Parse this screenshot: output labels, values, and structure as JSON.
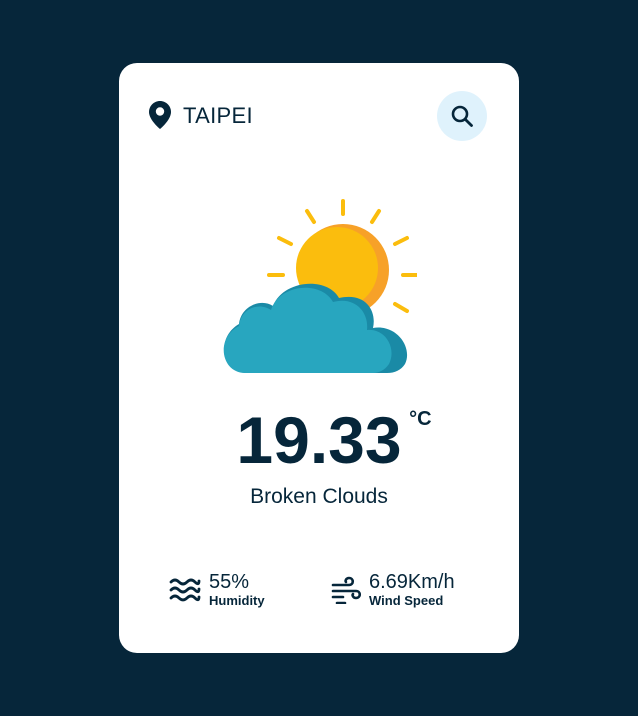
{
  "location": {
    "city": "TAIPEI",
    "icon": "location-pin-icon"
  },
  "search": {
    "icon": "search-icon",
    "bg_color": "#dff2fc"
  },
  "weather": {
    "icon": "sun-behind-cloud-icon",
    "temperature": "19.33",
    "unit": "°C",
    "description": "Broken Clouds"
  },
  "stats": {
    "humidity": {
      "value": "55%",
      "label": "Humidity",
      "icon": "waves-icon"
    },
    "wind": {
      "value": "6.69Km/h",
      "label": "Wind Speed",
      "icon": "wind-icon"
    }
  },
  "colors": {
    "background": "#06263a",
    "card": "#ffffff",
    "text": "#06263a",
    "sun": "#fbbd0d",
    "sun_shade": "#f7a128",
    "cloud": "#28a6bf",
    "cloud_shade": "#1a8aa6"
  }
}
